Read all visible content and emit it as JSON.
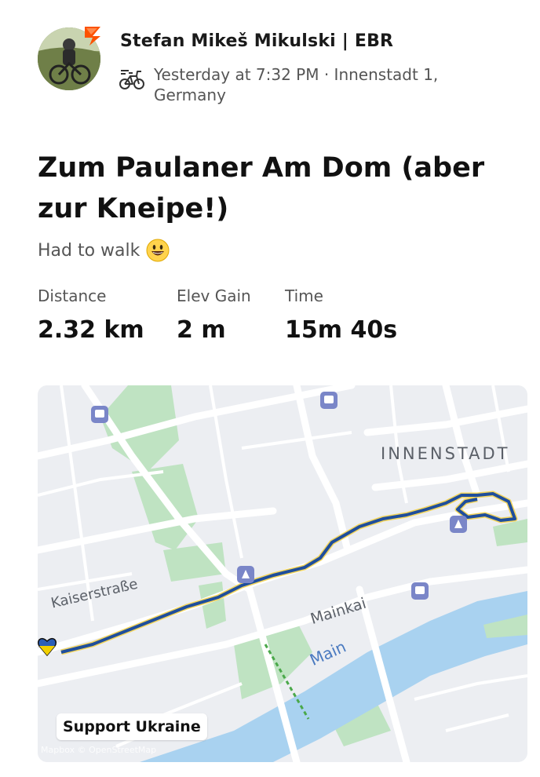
{
  "header": {
    "athlete_name": "Stefan  Mikeš Mikulski | EBR",
    "meta": "Yesterday at 7:32 PM · Innenstadt 1, Germany",
    "activity_type_icon": "bike-icon"
  },
  "activity": {
    "title": "Zum Paulaner Am Dom (aber zur Kneipe!)",
    "description": "Had to walk",
    "description_emoji": "smiley-icon"
  },
  "stats": [
    {
      "label": "Distance",
      "value": "2.32 km"
    },
    {
      "label": "Elev Gain",
      "value": "2 m"
    },
    {
      "label": "Time",
      "value": "15m 40s"
    }
  ],
  "map": {
    "labels": {
      "innenstadt": "INNENSTADT",
      "kaiserstrasse": "Kaiserstraße",
      "mainkai": "Mainkai",
      "main": "Main"
    },
    "support_button": "Support Ukraine",
    "attribution": "Mapbox © OpenStreetMap",
    "colors": {
      "route": "#1f4e9c",
      "route_highlight": "#f2d45c",
      "water": "#a9d2f0",
      "park": "#bfe3c2",
      "land": "#eceef2"
    }
  },
  "theme": {
    "brand_accent": "#fc5200"
  }
}
